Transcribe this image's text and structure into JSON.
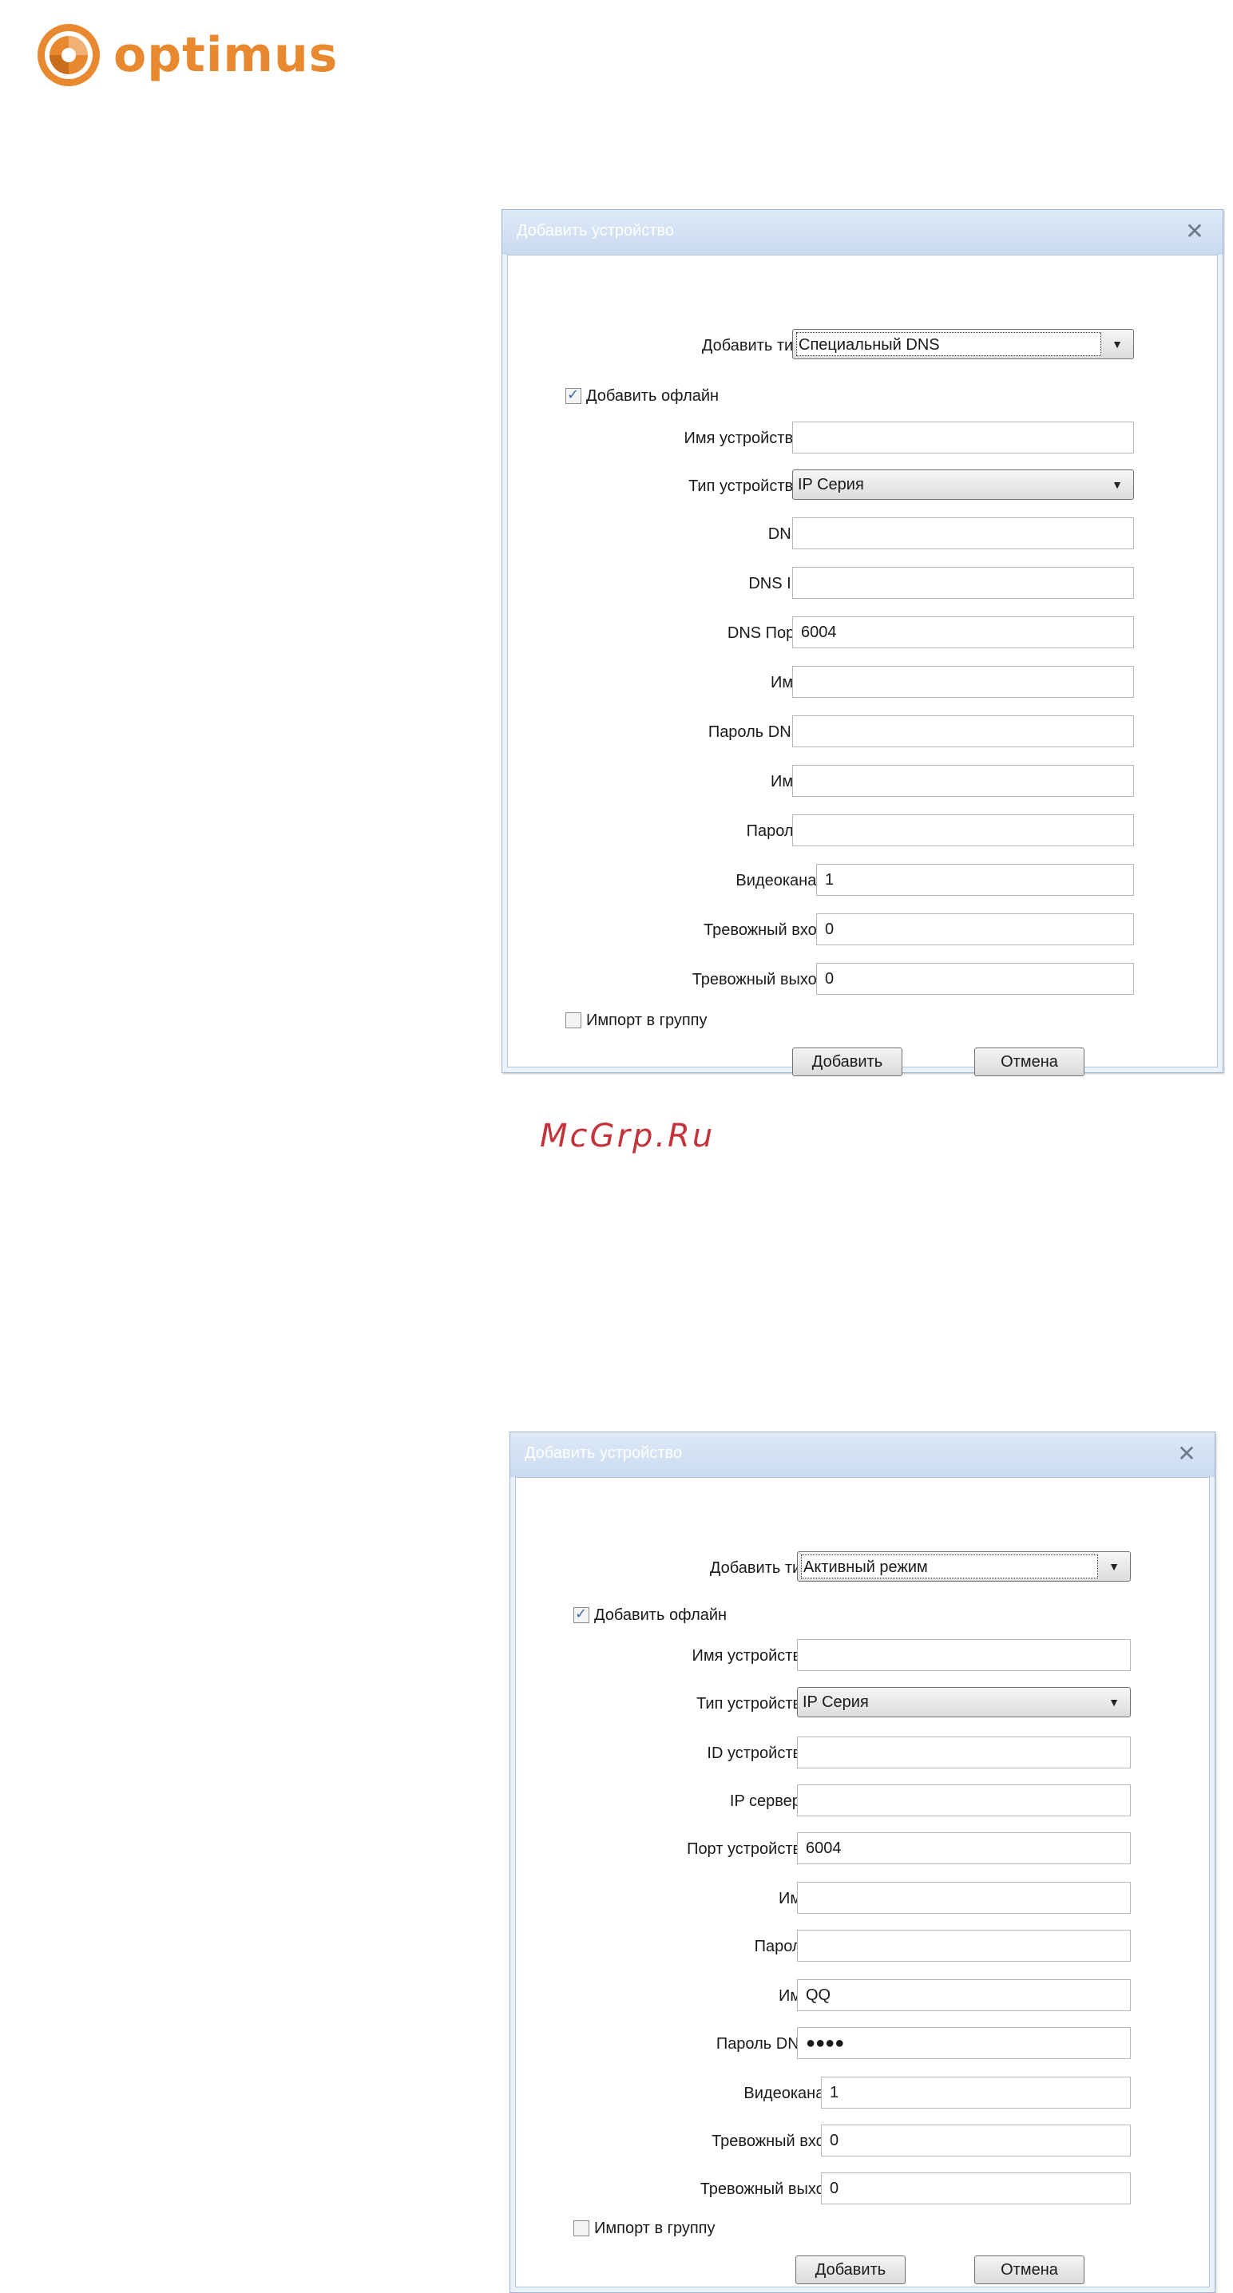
{
  "brand": {
    "name": "optimus",
    "color": "#e8892f"
  },
  "watermark": "McGrp.Ru",
  "dialogs": [
    {
      "title": "Добавить устройство",
      "add_type": {
        "label": "Добавить тип",
        "value": "Специальный DNS"
      },
      "offline": {
        "label": "Добавить офлайн",
        "checked": true
      },
      "device_name": {
        "label": "Имя устройства",
        "value": ""
      },
      "device_type": {
        "label": "Тип устройства",
        "value": "IP Серия"
      },
      "fields": [
        {
          "label": "DNS",
          "value": ""
        },
        {
          "label": "DNS IP",
          "value": ""
        },
        {
          "label": "DNS Порт",
          "value": "6004"
        },
        {
          "label": "Имя",
          "value": ""
        },
        {
          "label": "Пароль DNS",
          "value": ""
        },
        {
          "label": "Имя",
          "value": ""
        },
        {
          "label": "Пароль",
          "value": ""
        }
      ],
      "channels": [
        {
          "label": "Видеоканал",
          "value": "1"
        },
        {
          "label": "Тревожный вход",
          "value": "0"
        },
        {
          "label": "Тревожный выход",
          "value": "0"
        }
      ],
      "import_group": {
        "label": "Импорт в группу",
        "checked": false
      },
      "add_button": "Добавить",
      "cancel_button": "Отмена"
    },
    {
      "title": "Добавить устройство",
      "add_type": {
        "label": "Добавить тип",
        "value": "Активный режим"
      },
      "offline": {
        "label": "Добавить офлайн",
        "checked": true
      },
      "device_name": {
        "label": "Имя устройства",
        "value": ""
      },
      "device_type": {
        "label": "Тип устройства",
        "value": "IP Серия"
      },
      "fields": [
        {
          "label": "ID устройства",
          "value": ""
        },
        {
          "label": "IP сервера",
          "value": ""
        },
        {
          "label": "Порт устройства",
          "value": "6004"
        },
        {
          "label": "Имя",
          "value": ""
        },
        {
          "label": "Пароль",
          "value": ""
        },
        {
          "label": "Имя",
          "value": "QQ"
        },
        {
          "label": "Пароль DNS",
          "value": "●●●●"
        }
      ],
      "channels": [
        {
          "label": "Видеоканал",
          "value": "1"
        },
        {
          "label": "Тревожный вход",
          "value": "0"
        },
        {
          "label": "Тревожный выход",
          "value": "0"
        }
      ],
      "import_group": {
        "label": "Импорт в группу",
        "checked": false
      },
      "add_button": "Добавить",
      "cancel_button": "Отмена"
    }
  ]
}
